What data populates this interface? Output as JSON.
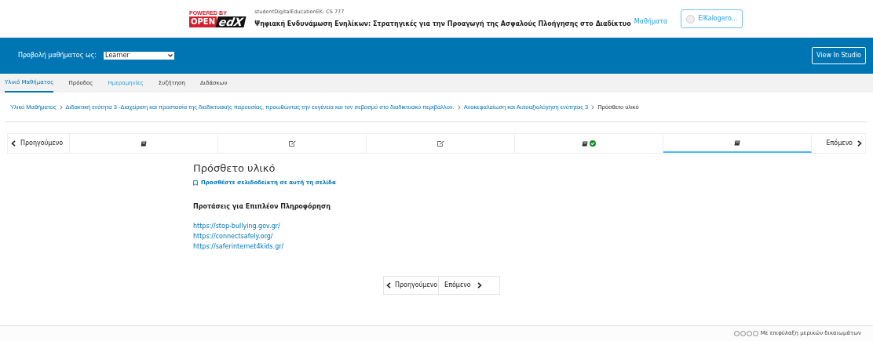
{
  "header": {
    "logo": {
      "powered": "POWERED BY",
      "open": "OPEN",
      "edx": "edX"
    },
    "course_code": "studentDigitalEducationEK: CS 777",
    "course_title": "Ψηφιακή Ενδυνάμωση Ενηλίκων: Στρατηγικές για την Προαγωγή της Ασφαλούς Πλοήγησης στο Διαδίκτυο",
    "courses_link": "Μαθήματα",
    "user": "ElKalogero..."
  },
  "preview_bar": {
    "label": "Προβολή μαθήματος ως:",
    "select_value": "Learner",
    "studio_button": "View In Studio"
  },
  "tabs": [
    {
      "label": "Υλικό Μαθήματος",
      "selected": true,
      "hovered": false
    },
    {
      "label": "Πρόοδος",
      "selected": false,
      "hovered": false
    },
    {
      "label": "Ημερομηνίες",
      "selected": false,
      "hovered": true
    },
    {
      "label": "Συζήτηση",
      "selected": false,
      "hovered": false
    },
    {
      "label": "Διδάσκων",
      "selected": false,
      "hovered": false
    }
  ],
  "breadcrumbs": [
    {
      "label": "Υλικό Μαθήματος",
      "kind": "link"
    },
    {
      "label": "Διδακτική ενότητα 3 -Διαχείριση και προστασία της διαδικτυακής παρουσίας, προωθώντας την ευγένεια και τον σεβασμό στο διαδικτυακό περιβάλλον.",
      "kind": "link"
    },
    {
      "label": "Ανακεφαλαίωση και Αυτοαξιολόγηση ενότητας 3",
      "kind": "link"
    },
    {
      "label": "Πρόσθετο υλικό",
      "kind": "current"
    }
  ],
  "sequence": {
    "previous": "Προηγούμενο",
    "next": "Επόμενο",
    "units": [
      {
        "kind": "book",
        "completed": false,
        "selected": false
      },
      {
        "kind": "edit",
        "completed": false,
        "selected": false
      },
      {
        "kind": "edit",
        "completed": false,
        "selected": false
      },
      {
        "kind": "book",
        "completed": true,
        "selected": false
      },
      {
        "kind": "book",
        "completed": false,
        "selected": true
      }
    ]
  },
  "content": {
    "title": "Πρόσθετο υλικό",
    "bookmark": "Προσθέστε σελιδοδείκτη σε αυτή τη σελίδα",
    "heading": "Προτάσεις για Επιπλέον Πληροφόρηση",
    "links": [
      "https://stop-bullying.gov.gr/",
      "https://connectsafely.org/",
      "https://saferinternet4kids.gr/"
    ]
  },
  "bottom_nav": {
    "previous": "Προηγούμενο",
    "next": "Επόμενο"
  },
  "footer": {
    "license": "Με επιφύλαξη μερικών δικαιωμάτων"
  }
}
